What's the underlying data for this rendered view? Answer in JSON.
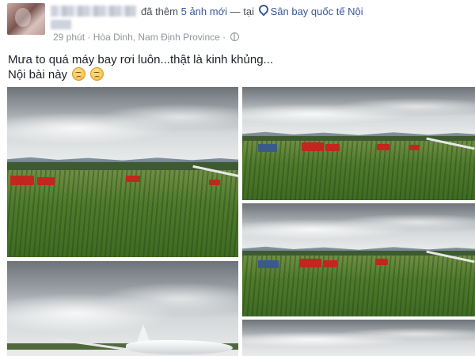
{
  "header": {
    "action_text": "đã thêm",
    "photo_count_text": "5 ảnh mới",
    "separator": "— tại",
    "location": "Sân bay quốc tế Nội"
  },
  "meta": {
    "time": "29 phút",
    "dot": "·",
    "place": "Hòa Dinh, Nam Định Province",
    "dot2": "·"
  },
  "post": {
    "line1": "Mưa to quá máy bay rơi luôn...thật là kinh khủng...",
    "line2": "Nội bài này"
  },
  "icons": {
    "location": "location-pin-icon",
    "privacy": "globe-icon",
    "emoji": "sad-face-emoji"
  },
  "colors": {
    "link": "#365899",
    "meta": "#90949c",
    "text": "#1d2129"
  }
}
